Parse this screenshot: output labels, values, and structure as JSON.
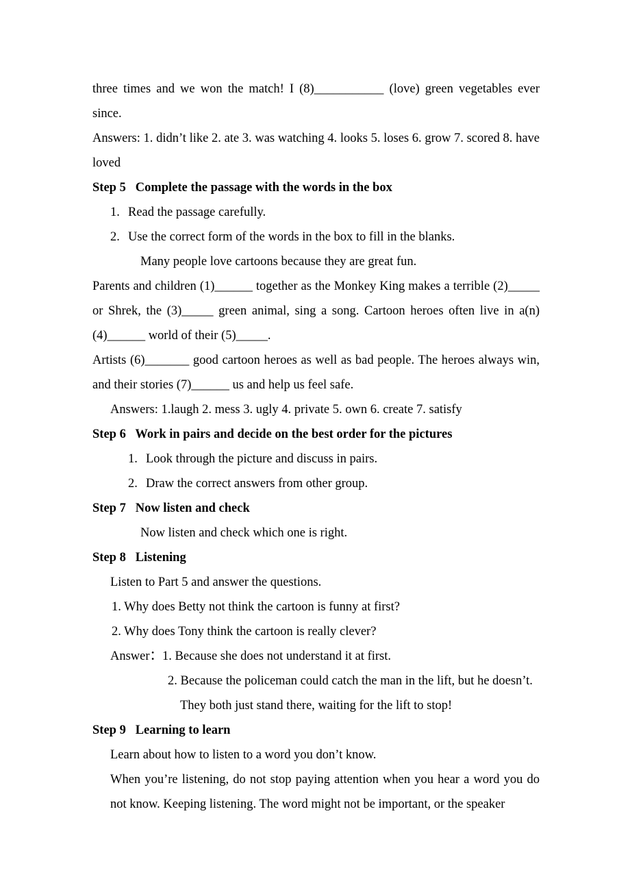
{
  "document": {
    "type": "lesson-plan-page",
    "language": "en",
    "page_background": "#ffffff",
    "text_color": "#000000"
  },
  "continued_paragraph": {
    "line_1": "three times and we won the match! I (8)___________ (love) green vegetables ever",
    "line_2": "since.",
    "full": "three times and we won the match! I (8)___________ (love) green vegetables ever since."
  },
  "answers_block_1": {
    "label": "Answers:",
    "full": "Answers: 1. didn’t like 2. ate    3. was watching 4. looks    5. loses    6. grow    7. scored    8. have loved",
    "items": [
      {
        "number": "1.",
        "value": "didn’t like"
      },
      {
        "number": "2.",
        "value": "ate"
      },
      {
        "number": "3.",
        "value": "was watching"
      },
      {
        "number": "4.",
        "value": "looks"
      },
      {
        "number": "5.",
        "value": "loses"
      },
      {
        "number": "6.",
        "value": "grow"
      },
      {
        "number": "7.",
        "value": "scored"
      },
      {
        "number": "8.",
        "value": "have loved"
      }
    ]
  },
  "step5": {
    "label": "Step 5",
    "title": "Complete the passage with the words in the box",
    "instructions": [
      {
        "number": "1.",
        "text": "Read the passage carefully."
      },
      {
        "number": "2.",
        "text": "Use the correct form of the words in the box to fill in the blanks."
      }
    ],
    "lead_in": "Many people love cartoons because they are great fun.",
    "passage_paragraph_1": "Parents and children (1)______ together as the Monkey King makes a terrible (2)_____ or Shrek, the (3)_____ green animal, sing a song. Cartoon heroes often live in a(n) (4)______ world of their (5)_____.",
    "passage_paragraph_2": "Artists (6)_______ good cartoon heroes as well as bad people. The heroes always win, and their stories (7)______ us and help us feel safe.",
    "answers": {
      "label": "Answers:",
      "full": "Answers: 1.laugh   2. mess   3. ugly   4. private   5. own   6. create   7. satisfy",
      "items": [
        {
          "number": "1.",
          "value": "laugh"
        },
        {
          "number": "2.",
          "value": "mess"
        },
        {
          "number": "3.",
          "value": "ugly"
        },
        {
          "number": "4.",
          "value": "private"
        },
        {
          "number": "5.",
          "value": "own"
        },
        {
          "number": "6.",
          "value": "create"
        },
        {
          "number": "7.",
          "value": "satisfy"
        }
      ]
    }
  },
  "step6": {
    "label": "Step 6",
    "title": "Work in pairs and decide on the best order for the pictures",
    "instructions": [
      {
        "number": "1.",
        "text": "Look through the picture and discuss in pairs."
      },
      {
        "number": "2.",
        "text": "Draw the correct answers from other group."
      }
    ]
  },
  "step7": {
    "label": "Step 7",
    "title": "Now listen and check",
    "body": "Now listen and check which one is right."
  },
  "step8": {
    "label": "Step 8",
    "title": "Listening",
    "body": "Listen to Part 5 and answer the questions.",
    "questions": [
      "1. Why does Betty not think the cartoon is funny at first?",
      "2. Why does Tony think the cartoon is really clever?"
    ],
    "answer_label": "Answer：",
    "answers": [
      "1. Because she does not understand it at first.",
      "2. Because the policeman could catch the man in the lift, but he doesn’t.",
      "They both just stand there, waiting for the lift to stop!"
    ]
  },
  "step9": {
    "label": "Step 9",
    "title": "Learning to learn",
    "body_1": "Learn about how to listen to a word you don’t know.",
    "body_2": "When you’re listening, do not stop paying attention when you hear a word you do not know. Keeping listening. The word might not be important, or the speaker"
  }
}
